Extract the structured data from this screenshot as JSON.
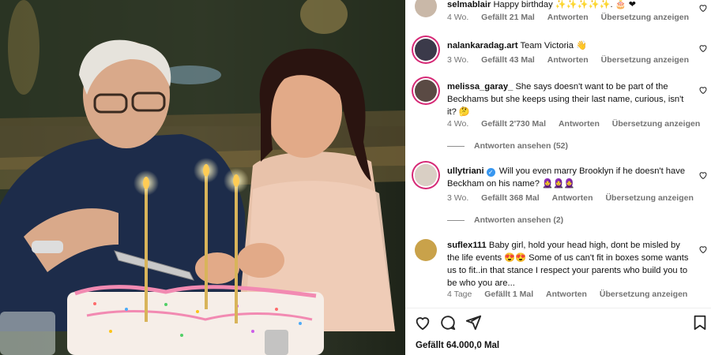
{
  "comments": [
    {
      "username": "selmablair",
      "verified": false,
      "text": "Happy birthday ✨✨✨✨✨. 🎂 ❤",
      "age": "4 Wo.",
      "likes": "Gefällt 21 Mal",
      "reply_label": "Antworten",
      "translate_label": "Übersetzung anzeigen",
      "avatar_color": "#c9b8a8"
    },
    {
      "username": "nalankaradag.art",
      "verified": false,
      "text": "Team Victoria 👋",
      "age": "3 Wo.",
      "likes": "Gefällt 43 Mal",
      "reply_label": "Antworten",
      "translate_label": "Übersetzung anzeigen",
      "avatar_color": "#3b3a4a"
    },
    {
      "username": "melissa_garay_",
      "verified": false,
      "text": "She says doesn't want to be part of the Beckhams but she keeps using their last name, curious, isn't it? 🤔",
      "age": "4 Wo.",
      "likes": "Gefällt 2'730 Mal",
      "reply_label": "Antworten",
      "translate_label": "Übersetzung anzeigen",
      "view_replies": "Antworten ansehen (52)",
      "avatar_color": "#5a4a44"
    },
    {
      "username": "ullytriani",
      "verified": true,
      "text": "Will you even marry Brooklyn if he doesn't have Beckham on his name? 🧕🧕🧕",
      "age": "3 Wo.",
      "likes": "Gefällt 368 Mal",
      "reply_label": "Antworten",
      "translate_label": "Übersetzung anzeigen",
      "view_replies": "Antworten ansehen (2)",
      "avatar_color": "#d9cfc4"
    },
    {
      "username": "suflex111",
      "verified": false,
      "text": "Baby girl, hold your head high, dont be misled by the life events 😍😍 Some of us can't fit in boxes some wants us to fit..in that stance I respect your parents who build you to be who you are...",
      "age": "4 Tage",
      "likes": "Gefällt 1 Mal",
      "reply_label": "Antworten",
      "translate_label": "Übersetzung anzeigen",
      "avatar_color": "#c9a24a"
    }
  ],
  "actions": {
    "like_icon": "heart-icon",
    "comment_icon": "comment-icon",
    "share_icon": "send-icon",
    "save_icon": "bookmark-icon"
  },
  "total_likes": "Gefällt 64.000,0 Mal",
  "photo_description_icons": {
    "cake": "birthday-cake",
    "candles": "candles"
  }
}
